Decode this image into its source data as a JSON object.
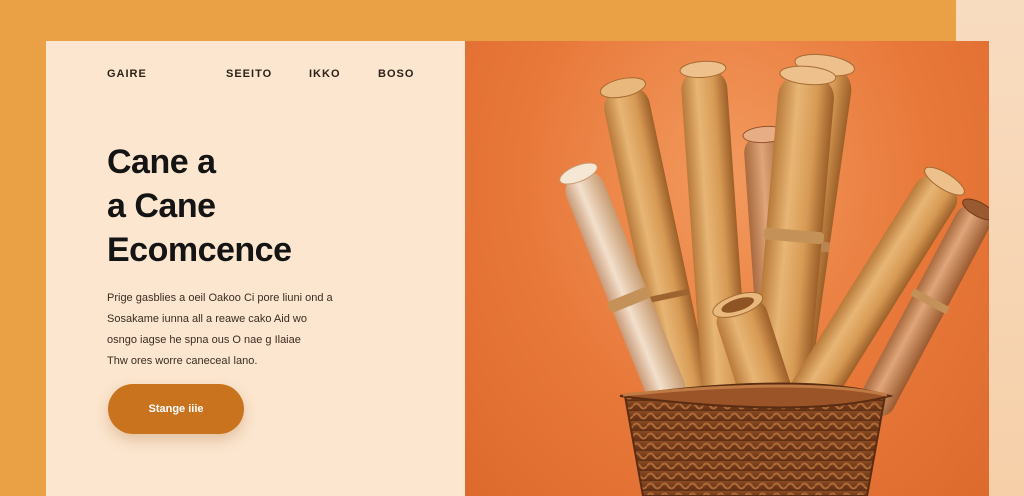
{
  "nav": {
    "items": [
      "GAIRE",
      "SEEITO",
      "IKKO",
      "BOSO"
    ]
  },
  "hero": {
    "title_lines": [
      "Cane a",
      "a Cane",
      "Ecomcence"
    ],
    "description_lines": [
      "Prige gasblies a oeil Oakoo Ci pore liuni ond a",
      "Sosakame iunna all a reawe cako Aid wo",
      "osngo iagse he spna ous O nae g Ilaiae",
      "Thw ores worre caneceaI lano."
    ],
    "cta_label": "Stange iiie"
  },
  "colors": {
    "background": "#eaa045",
    "left_panel": "#fce6cf",
    "right_panel": "#e8783a",
    "cta": "#c9731f"
  },
  "image": {
    "subject": "bamboo-cane-sticks-in-wicker-basket"
  }
}
